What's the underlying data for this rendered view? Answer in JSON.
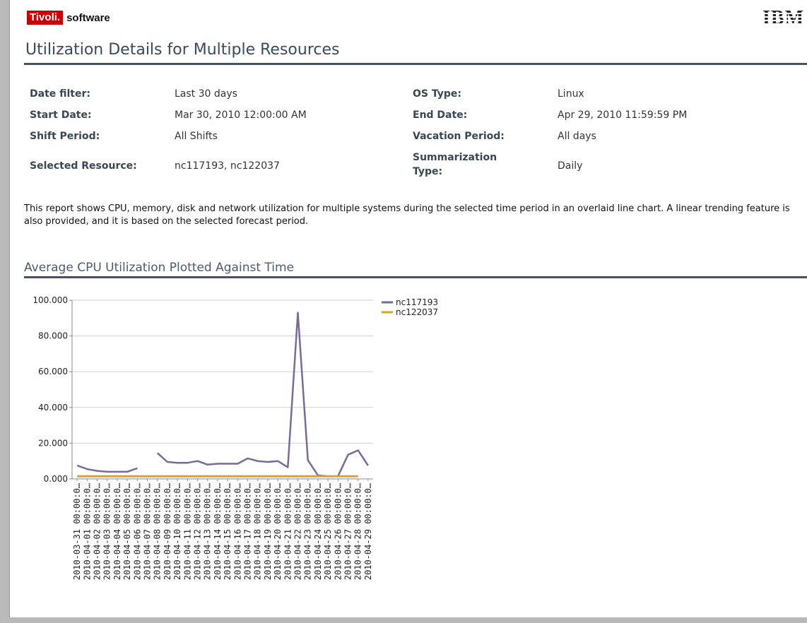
{
  "brand": {
    "tivoli": "Tivoli.",
    "software": "software",
    "ibm": "IBM"
  },
  "page_title": "Utilization Details for Multiple Resources",
  "filters": {
    "date_filter_label": "Date filter:",
    "date_filter_value": "Last 30 days",
    "os_type_label": "OS Type:",
    "os_type_value": "Linux",
    "start_date_label": "Start Date:",
    "start_date_value": "Mar 30, 2010 12:00:00 AM",
    "end_date_label": "End Date:",
    "end_date_value": "Apr 29, 2010 11:59:59 PM",
    "shift_period_label": "Shift Period:",
    "shift_period_value": "All Shifts",
    "vacation_period_label": "Vacation Period:",
    "vacation_period_value": "All days",
    "selected_resource_label": "Selected Resource:",
    "selected_resource_value": "nc117193, nc122037",
    "summarization_type_label_1": "Summarization",
    "summarization_type_label_2": "Type:",
    "summarization_type_value": "Daily"
  },
  "description": "This report shows CPU, memory, disk and network utilization for multiple systems during the selected time period in an overlaid line chart. A linear trending feature is also provided, and it is based on the selected forecast period.",
  "section_title": "Average CPU Utilization Plotted Against Time",
  "chart_data": {
    "type": "line",
    "title": "Average CPU Utilization Plotted Against Time",
    "xlabel": "",
    "ylabel": "",
    "ylim": [
      0,
      100
    ],
    "yticks": [
      "0.000",
      "20.000",
      "40.000",
      "60.000",
      "80.000",
      "100.000"
    ],
    "grid": true,
    "legend_position": "top-right",
    "categories": [
      "2010-03-31 00:00:0…",
      "2010-04-01 00:00:0…",
      "2010-04-02 00:00:0…",
      "2010-04-03 00:00:0…",
      "2010-04-04 00:00:0…",
      "2010-04-05 00:00:0…",
      "2010-04-06 00:00:0…",
      "2010-04-07 00:00:0…",
      "2010-04-08 00:00:0…",
      "2010-04-09 00:00:0…",
      "2010-04-10 00:00:0…",
      "2010-04-11 00:00:0…",
      "2010-04-12 00:00:0…",
      "2010-04-13 00:00:0…",
      "2010-04-14 00:00:0…",
      "2010-04-15 00:00:0…",
      "2010-04-16 00:00:0…",
      "2010-04-17 00:00:0…",
      "2010-04-18 00:00:0…",
      "2010-04-19 00:00:0…",
      "2010-04-20 00:00:0…",
      "2010-04-21 00:00:0…",
      "2010-04-22 00:00:0…",
      "2010-04-23 00:00:0…",
      "2010-04-24 00:00:0…",
      "2010-04-25 00:00:0…",
      "2010-04-26 00:00:0…",
      "2010-04-27 00:00:0…",
      "2010-04-28 00:00:0…",
      "2010-04-29 00:00:0…"
    ],
    "series": [
      {
        "name": "nc117193",
        "color": "#7a6a9a",
        "values": [
          7.5,
          5.5,
          4.5,
          4.0,
          4.0,
          4.0,
          6.0,
          null,
          14.5,
          9.5,
          9.0,
          9.0,
          10.0,
          8.0,
          8.5,
          8.5,
          8.5,
          11.5,
          10.0,
          9.5,
          10.0,
          6.5,
          93.0,
          10.5,
          2.0,
          1.5,
          1.5,
          13.5,
          16.0,
          7.5
        ]
      },
      {
        "name": "nc122037",
        "color": "#e0a030",
        "values": [
          1.5,
          1.5,
          1.5,
          1.5,
          1.5,
          1.5,
          1.5,
          1.5,
          1.5,
          1.5,
          1.5,
          1.5,
          1.5,
          1.5,
          1.5,
          1.5,
          1.5,
          1.5,
          1.5,
          1.5,
          1.5,
          1.5,
          1.5,
          1.5,
          1.5,
          1.5,
          1.5,
          1.5,
          1.5,
          null
        ]
      }
    ]
  }
}
